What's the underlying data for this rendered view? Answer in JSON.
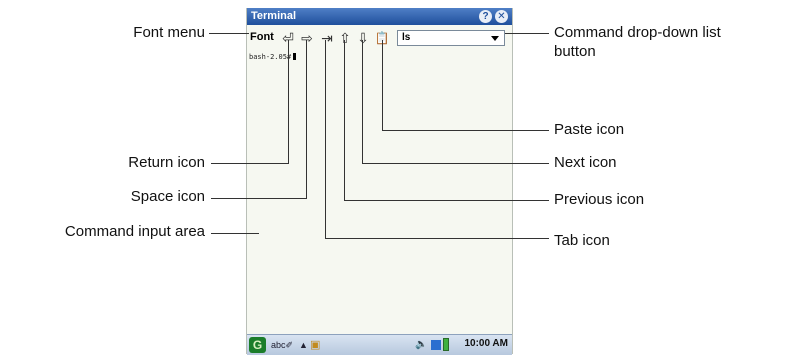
{
  "callouts": {
    "font_menu": "Font menu",
    "return_icon": "Return icon",
    "space_icon": "Space icon",
    "command_input_area": "Command input area",
    "command_dropdown_line1": "Command drop-down list",
    "command_dropdown_line2": "button",
    "paste_icon": "Paste icon",
    "next_icon": "Next icon",
    "previous_icon": "Previous icon",
    "tab_icon": "Tab icon"
  },
  "window": {
    "title": "Terminal",
    "help_glyph": "?",
    "close_glyph": "✕"
  },
  "toolbar": {
    "font_label": "Font",
    "icons": [
      {
        "name": "return-icon",
        "glyph": "⏎"
      },
      {
        "name": "space-icon",
        "glyph": "⇨"
      },
      {
        "name": "tab-icon",
        "glyph": "⇥"
      },
      {
        "name": "previous-icon",
        "glyph": "⇧"
      },
      {
        "name": "next-icon",
        "glyph": "⇩"
      },
      {
        "name": "paste-icon",
        "glyph": "📋"
      }
    ],
    "command_value": "ls"
  },
  "terminal": {
    "prompt": "bash-2.05#"
  },
  "taskbar": {
    "start_glyph": "G",
    "input_glyph": "abc✐",
    "up_glyph": "▲",
    "app_glyph": "▣",
    "speaker_glyph": "🔈",
    "clock": "10:00 AM"
  },
  "colors": {
    "titlebar": "#1f4f9c",
    "start_button": "#1b7d2a",
    "battery": "#3fb13f"
  }
}
